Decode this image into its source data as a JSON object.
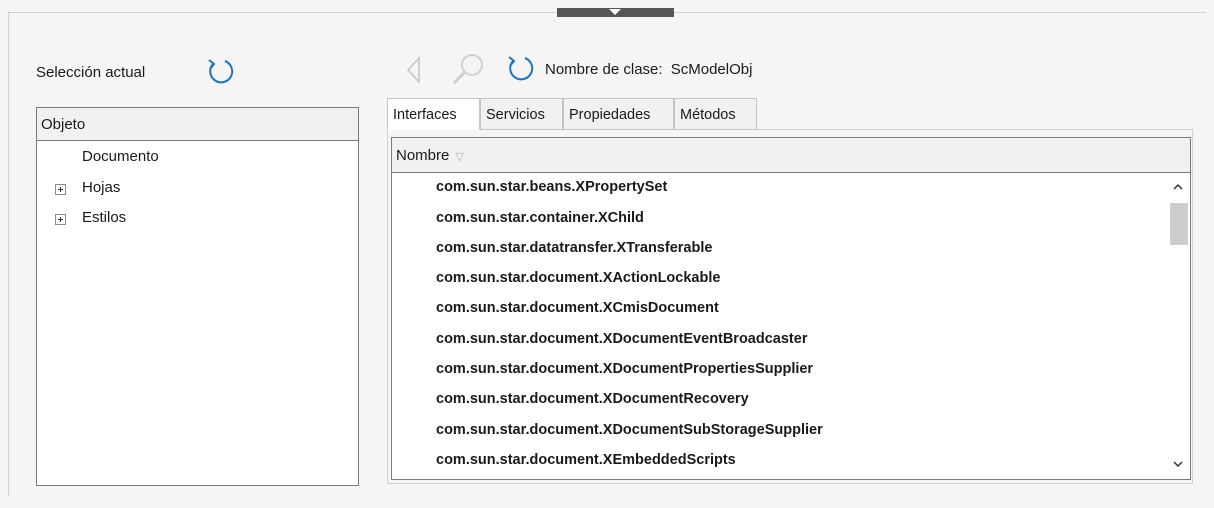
{
  "left_panel": {
    "selection_label": "Selección actual",
    "tree_header": "Objeto",
    "tree_items": [
      {
        "label": "Documento",
        "expandable": false
      },
      {
        "label": "Hojas",
        "expandable": true
      },
      {
        "label": "Estilos",
        "expandable": true
      }
    ]
  },
  "toolbar": {
    "back_icon": "back-arrow-icon",
    "search_icon": "magnifier-icon",
    "refresh_icon": "refresh-icon",
    "class_label": "Nombre de clase:",
    "class_value": "ScModelObj"
  },
  "tabs": [
    {
      "label": "Interfaces",
      "active": true
    },
    {
      "label": "Servicios",
      "active": false
    },
    {
      "label": "Propiedades",
      "active": false
    },
    {
      "label": "Métodos",
      "active": false
    }
  ],
  "list": {
    "column_header": "Nombre",
    "rows": [
      "com.sun.star.beans.XPropertySet",
      "com.sun.star.container.XChild",
      "com.sun.star.datatransfer.XTransferable",
      "com.sun.star.document.XActionLockable",
      "com.sun.star.document.XCmisDocument",
      "com.sun.star.document.XDocumentEventBroadcaster",
      "com.sun.star.document.XDocumentPropertiesSupplier",
      "com.sun.star.document.XDocumentRecovery",
      "com.sun.star.document.XDocumentSubStorageSupplier",
      "com.sun.star.document.XEmbeddedScripts"
    ]
  },
  "colors": {
    "accent": "#1c74c7",
    "disabled_icon": "#c8c8c8"
  }
}
